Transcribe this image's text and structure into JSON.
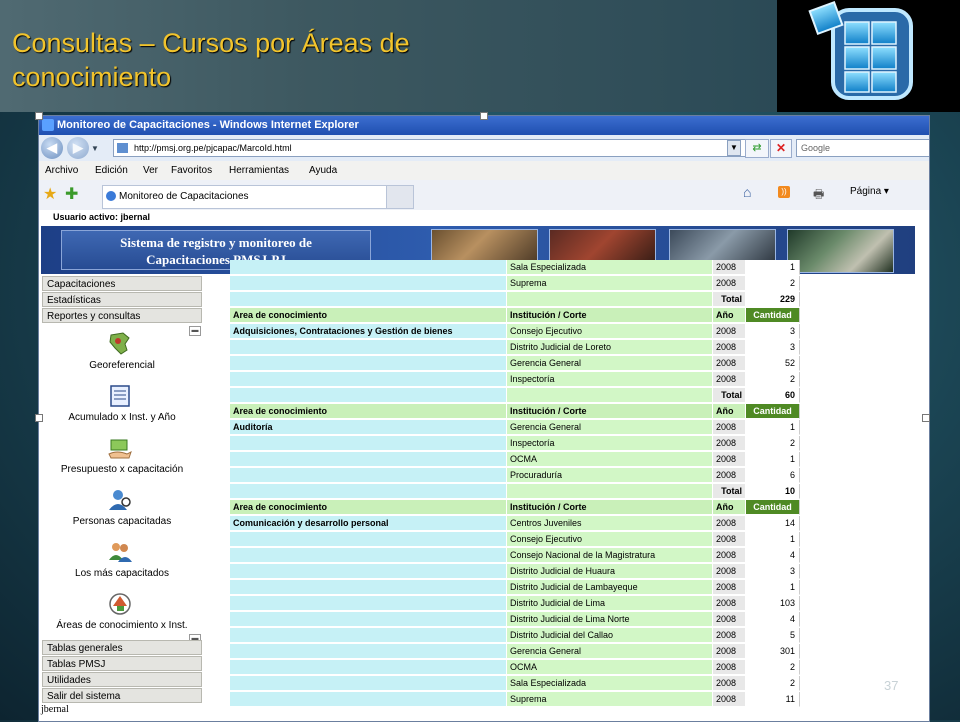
{
  "slide": {
    "title_line1": "Consultas – Cursos por  Áreas de",
    "title_line2": "conocimiento",
    "number": "37"
  },
  "browser": {
    "window_title": "Monitoreo de Capacitaciones - Windows Internet Explorer",
    "address": "http://pmsj.org.pe/pjcapac/MarcoId.html",
    "search_placeholder": "Google",
    "menu": [
      "Archivo",
      "Edición",
      "Ver",
      "Favoritos",
      "Herramientas",
      "Ayuda"
    ],
    "tab_label": "Monitoreo de Capacitaciones",
    "page_menu": "Página"
  },
  "app": {
    "active_user_label": "Usuario activo:  jbernal",
    "banner_line1": "Sistema de registro y monitoreo de",
    "banner_line2": "Capacitaciones PMSJ-PJ",
    "user_bottom": "jbernal"
  },
  "sidebar": {
    "top_menu": [
      "Capacitaciones",
      "Estadísticas",
      "Reportes y consultas"
    ],
    "icon_items": [
      {
        "label": "Georeferencial",
        "icon": "map-icon"
      },
      {
        "label": "Acumulado x  Inst. y Año",
        "icon": "notebook-icon"
      },
      {
        "label": "Presupuesto x capacitación",
        "icon": "money-hand-icon"
      },
      {
        "label": "Personas capacitadas",
        "icon": "person-search-icon"
      },
      {
        "label": "Los más capacitados",
        "icon": "users-icon"
      },
      {
        "label": "Áreas de conocimiento x Inst.",
        "icon": "areas-icon"
      }
    ],
    "bottom_menu": [
      "Tablas generales",
      "Tablas PMSJ",
      "Utilidades",
      "Salir del sistema"
    ]
  },
  "table": {
    "header": {
      "area": "Area de conocimiento",
      "inst": "Institución / Corte",
      "year": "Año",
      "qty": "Cantidad"
    },
    "total_label": "Total",
    "rows": [
      {
        "type": "data",
        "area": "",
        "inst": "Sala Especializada",
        "year": "2008",
        "qty": "1"
      },
      {
        "type": "data",
        "area": "",
        "inst": "Suprema",
        "year": "2008",
        "qty": "2"
      },
      {
        "type": "total",
        "qty": "229"
      },
      {
        "type": "header"
      },
      {
        "type": "data",
        "area": "Adquisiciones, Contrataciones y Gestión de bienes",
        "inst": "Consejo Ejecutivo",
        "year": "2008",
        "qty": "3"
      },
      {
        "type": "data",
        "area": "",
        "inst": "Distrito Judicial de Loreto",
        "year": "2008",
        "qty": "3"
      },
      {
        "type": "data",
        "area": "",
        "inst": "Gerencia General",
        "year": "2008",
        "qty": "52"
      },
      {
        "type": "data",
        "area": "",
        "inst": "Inspectoría",
        "year": "2008",
        "qty": "2"
      },
      {
        "type": "total",
        "qty": "60"
      },
      {
        "type": "header"
      },
      {
        "type": "data",
        "area": "Auditoría",
        "inst": "Gerencia General",
        "year": "2008",
        "qty": "1"
      },
      {
        "type": "data",
        "area": "",
        "inst": "Inspectoría",
        "year": "2008",
        "qty": "2"
      },
      {
        "type": "data",
        "area": "",
        "inst": "OCMA",
        "year": "2008",
        "qty": "1"
      },
      {
        "type": "data",
        "area": "",
        "inst": "Procuraduría",
        "year": "2008",
        "qty": "6"
      },
      {
        "type": "total",
        "qty": "10"
      },
      {
        "type": "header"
      },
      {
        "type": "data",
        "area": "Comunicación y desarrollo personal",
        "inst": "Centros Juveniles",
        "year": "2008",
        "qty": "14"
      },
      {
        "type": "data",
        "area": "",
        "inst": "Consejo Ejecutivo",
        "year": "2008",
        "qty": "1"
      },
      {
        "type": "data",
        "area": "",
        "inst": "Consejo Nacional de la Magistratura",
        "year": "2008",
        "qty": "4"
      },
      {
        "type": "data",
        "area": "",
        "inst": "Distrito Judicial de Huaura",
        "year": "2008",
        "qty": "3"
      },
      {
        "type": "data",
        "area": "",
        "inst": "Distrito Judicial de Lambayeque",
        "year": "2008",
        "qty": "1"
      },
      {
        "type": "data",
        "area": "",
        "inst": "Distrito Judicial de Lima",
        "year": "2008",
        "qty": "103"
      },
      {
        "type": "data",
        "area": "",
        "inst": "Distrito Judicial de Lima Norte",
        "year": "2008",
        "qty": "4"
      },
      {
        "type": "data",
        "area": "",
        "inst": "Distrito Judicial del Callao",
        "year": "2008",
        "qty": "5"
      },
      {
        "type": "data",
        "area": "",
        "inst": "Gerencia General",
        "year": "2008",
        "qty": "301"
      },
      {
        "type": "data",
        "area": "",
        "inst": "OCMA",
        "year": "2008",
        "qty": "2"
      },
      {
        "type": "data",
        "area": "",
        "inst": "Sala Especializada",
        "year": "2008",
        "qty": "2"
      },
      {
        "type": "data",
        "area": "",
        "inst": "Suprema",
        "year": "2008",
        "qty": "11"
      }
    ]
  },
  "colors": {
    "title": "#f2c42c",
    "qty_header_bg": "#4f8a24",
    "area_cell": "#c6f1f6",
    "inst_cell": "#d2f7c6"
  }
}
